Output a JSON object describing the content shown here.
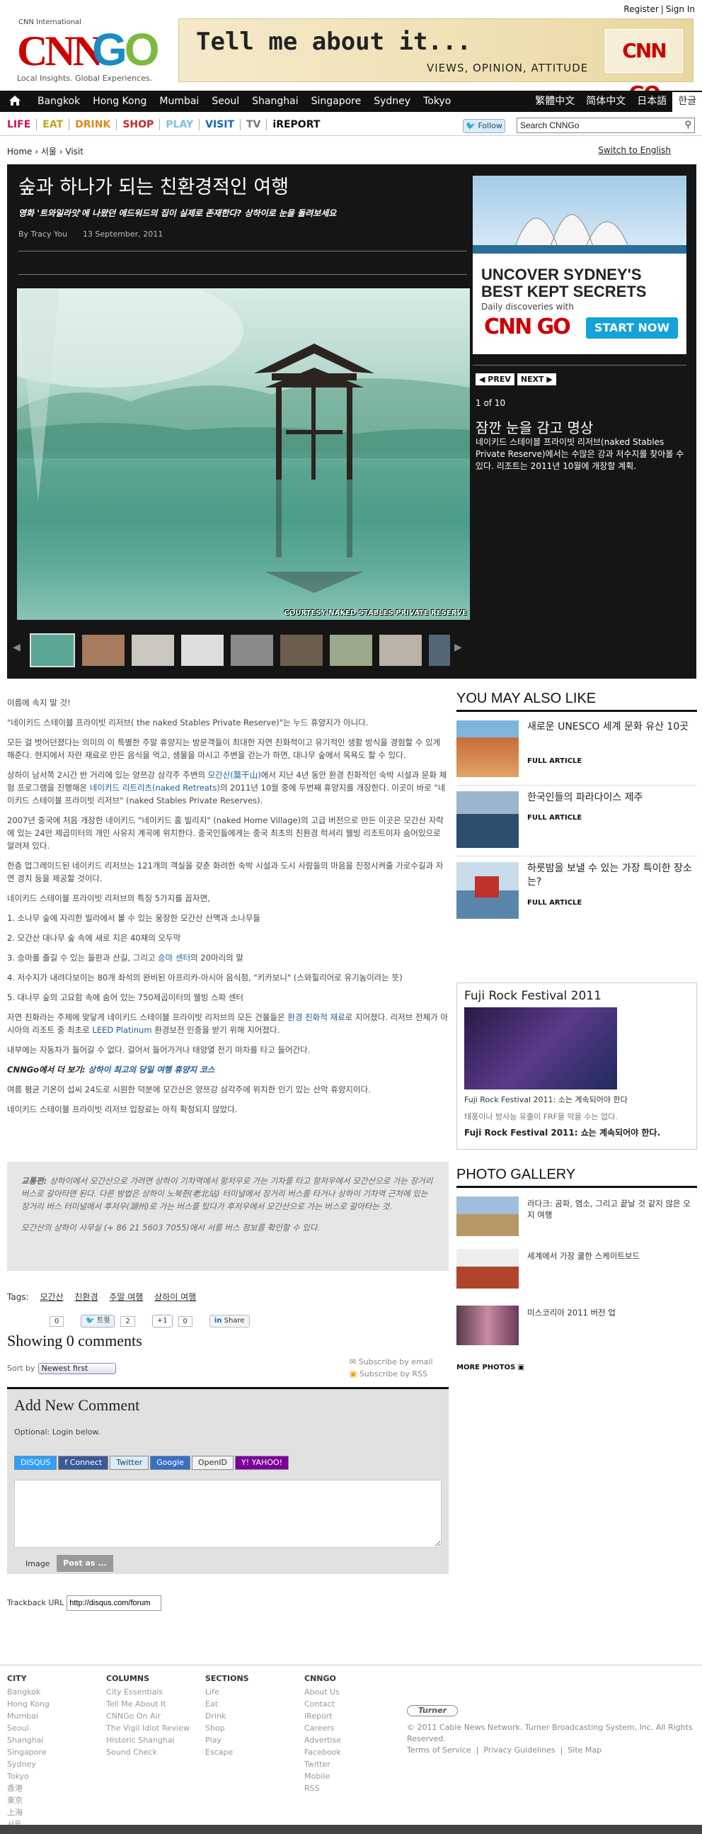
{
  "header": {
    "auth": {
      "register": "Register",
      "signin": "Sign In"
    },
    "logo": {
      "intl": "CNN International",
      "cnn": "CNN",
      "go": "GO",
      "tagline": "Local Insights. Global Experiences."
    },
    "banner": {
      "headline": "Tell me about it...",
      "sub": "VIEWS, OPINION, ATTITUDE",
      "logo": "CNN GO"
    }
  },
  "city_nav": {
    "cities": [
      "Bangkok",
      "Hong Kong",
      "Mumbai",
      "Seoul",
      "Shanghai",
      "Singapore",
      "Sydney",
      "Tokyo"
    ],
    "languages": [
      "繁體中文",
      "简体中文",
      "日本語",
      "한글"
    ]
  },
  "section_nav": {
    "items": [
      {
        "label": "LIFE",
        "color": "#c2185b"
      },
      {
        "label": "EAT",
        "color": "#c0a51b"
      },
      {
        "label": "DRINK",
        "color": "#e08a1e"
      },
      {
        "label": "SHOP",
        "color": "#c62828"
      },
      {
        "label": "PLAY",
        "color": "#7ec1e0"
      },
      {
        "label": "VISIT",
        "color": "#1565c0"
      },
      {
        "label": "TV",
        "color": "#777777"
      },
      {
        "label": "iREPORT",
        "color": "#111111"
      }
    ],
    "follow": "Follow",
    "search_value": "Search CNNGo"
  },
  "breadcrumb": "Home › 서울 › Visit",
  "switch_lang": "Switch to English",
  "gallery": {
    "title": "숲과 하나가 되는 친환경적인 여행",
    "subtitle": "영화 '트와일라잇'에 나왔던 에드워드의 집이 실제로 존재한다? 상하이로 눈을 돌려보세요",
    "author": "By Tracy You",
    "date": "13 September, 2011",
    "photo_credit": "COURTESY NAKED STABLES PRIVATE RESERVE",
    "prev": "◀ PREV",
    "next": "NEXT ▶",
    "counter": "1 of 10",
    "caption_title": "잠깐 눈을 감고 명상",
    "caption_text": "네이키드 스테이블 프라이빗 리저브(naked Stables Private Reserve)에서는 수많은 강과 저수지를 찾아볼 수 있다. 리조트는 2011년 10월에 개장할 계획.",
    "ad": {
      "line1": "UNCOVER SYDNEY'S",
      "line2": "BEST KEPT SECRETS",
      "line3": "Daily discoveries with",
      "logo": "CNN GO",
      "cta": "START NOW"
    }
  },
  "article": {
    "p1": "이름에 속지 말 것!",
    "p2": "\"네이키드 스테이블 프라이빗 리저브( the naked Stables Private Reserve)\"는 누드 휴양지가 아니다.",
    "p3": "모든 걸 벗어던졌다는 의미의 이 특별한 주말 휴양지는 방문객들이 최대한 자연 친화적이고 유기적인 생활 방식을 경험할 수 있게 해준다. 현지에서 자란 재료로 만든 음식을 먹고, 샘물을 마시고 주변을 걷는가 하면, 대나무 숲에서 목욕도 할 수 있다.",
    "p4a": "상하이 남서쪽 2시간 반 거리에 있는 양쯔강 삼각주 주변의 ",
    "p4link1": "모간산(莫干山)",
    "p4b": "에서 지난 4년 동안 환경 친화적인 숙박 시설과 문화 체험 프로그램을 진행해온 ",
    "p4link2": "네이키드 리트리츠(naked Retreats)",
    "p4c": "의 2011년 10월 중에 두번째 휴양지를 개장한다. 이곳이 바로 \"네이키드 스테이블 프라이빗 리저브\" (naked Stables Private Reserves).",
    "p5": "2007년 중국에 처음 개장한 네이키드 \"네이키드 홈 빌리지\" (naked Home Village)의 고급 버전으로 만든 이곳은 모간산 자락에 있는 24만 제곱미터의 개인 사유지 계곡에 위치한다. 중국인들에게는 중국 최초의 친환경 럭셔리 웰빙 리조트이자 숨어있으로 알려져 있다.",
    "p6": "한층 업그레이드된 네이키드 리저브는 121개의 객실을 갖춘 화려한 숙박 시설과 도시 사람들의 마음을 진정시켜줄 가로수길과 자연 경치 등을 제공할 것이다.",
    "p7": "네이키드 스테이블 프라이빗 리저브의 특징 5가지를 꼽자면,",
    "li1": "1. 소나무 숲에 자리한 빌라에서 볼 수 있는 웅장한 모간산 산맥과 소나무들",
    "li2": "2. 모간산 대나무 숲 속에 새로 지은 40채의 오두막",
    "li3a": "3. 승마를 즐길 수 있는 들판과 산길, 그리고 ",
    "li3link": "승마 센터",
    "li3b": "의 20마리의 말",
    "li4": "4. 저수지가 내려다보이는 80개 좌석의 완비된 아프리카-아시아 음식점, \"키카보니\" (스와힐리어로 유기농이라는 뜻)",
    "li5": "5. 대나무 숲의 고요함 속에 숨어 있는 750제곱미터의 웰빙 스파 센터",
    "p8a": "자연 친화라는 주제에 맞닿게 네이키드 스테이블 프라이빗 리저브의 모든 건물들은 ",
    "p8link1": "환경 친화적 재료",
    "p8b": "로 지어졌다. 리저브 전체가 아시아의 리조트 중 최초로 ",
    "p8link2": "LEED Platinum",
    "p8c": " 환경보전 인증을 받기 위해 지어졌다.",
    "p9": "내부에는 자동차가 들어갈 수 없다. 걸어서 들어가거나 태양열 전기 마차를 타고 들어간다.",
    "more_label": "CNNGo에서 더 보기: ",
    "more_link": "상하이 최고의 당일 여행 휴양지 코스",
    "p10": "여름 평균 기온이 섭씨 24도로 시원한 덕분에 모간산은 양쯔강 삼각주에 위치한 인기 있는 산악 휴양지이다.",
    "p11": "네이키드 스테이블 프라이빗 리저브 입장료는 아직 확정되지 않았다.",
    "note1a": "교통편: ",
    "note1": "상하이에서 모간산으로 가려면 상하이 기차역에서 항저우로 가는 기차를 타고 항저우에서 모간산으로 가는 장거리 버스로 갈아타면 된다. 다른 방법은 상하이 노북쥔(老北站) 터미널에서 장거리 버스를 타거나 상하이 기차역 근처에 있는 장거리 버스 터미널에서 후저우(湖州)로 가는 버스를 탔다가 후저우에서 모간산으로 가는 버스로 갈아타는 것.",
    "note2": "모간산의 상하이 사무실 (+ 86 21 5603 7055)에서 서를 버스 정보를 확인할 수 있다."
  },
  "tags": {
    "label": "Tags:",
    "items": [
      "모간산",
      "친환경",
      "주말 여행",
      "상하이 여행"
    ]
  },
  "social": {
    "count1": "0",
    "tweet": "트윗",
    "tweet_count": "2",
    "plusone": "+1",
    "plus_count": "0",
    "share": "Share"
  },
  "comments": {
    "showing": "Showing 0 comments",
    "sort_label": "Sort by",
    "sort_value": "Newest first",
    "subscribe_email": "Subscribe by email",
    "subscribe_rss": "Subscribe by RSS",
    "add_title": "Add New Comment",
    "optional": "Optional: Login below.",
    "logins": [
      "DISQUS",
      "f Connect",
      "Twitter",
      "Google",
      "OpenID",
      "Y! YAHOO!"
    ],
    "image_label": "Image",
    "post_label": "Post as ...",
    "trackback_label": "Trackback URL",
    "trackback_value": "http://disqus.com/forum"
  },
  "right": {
    "also_like": "YOU MAY ALSO LIKE",
    "stories": [
      {
        "title": "새로운 UNESCO 세계 문화 유산 10곳",
        "link": "FULL ARTICLE"
      },
      {
        "title": "한국인들의 파라다이스 제주",
        "link": "FULL ARTICLE"
      },
      {
        "title": "하룻밤을 보낼 수 있는 가장 특이한 장소는?",
        "link": "FULL ARTICLE"
      }
    ],
    "fuji": {
      "title": "Fuji Rock Festival 2011",
      "caption": "Fuji Rock Festival 2011: 소는 계속되어야 한다",
      "desc": "태풍이나 방사능 유출이 FRF을 막을 수는 없다.",
      "link": "Fuji Rock Festival 2011: 쇼는 계속되어야 한다."
    },
    "photo_gallery": "PHOTO GALLERY",
    "gallery_items": [
      "라다크: 곰파, 염소, 그리고 끝날 것 같지 않은 오지 여행",
      "세계에서 가장 쿨한 스케이트보드",
      "미스코리아 2011 버전 업"
    ],
    "more_photos": "MORE PHOTOS"
  },
  "footer": {
    "city": {
      "title": "CITY",
      "items": [
        "Bangkok",
        "Hong Kong",
        "Mumbai",
        "Seoul",
        "Shanghai",
        "Singapore",
        "Sydney",
        "Tokyo",
        "香港",
        "東京",
        "上海",
        "서울"
      ]
    },
    "columns": {
      "title": "COLUMNS",
      "items": [
        "City Essentials",
        "Tell Me About It",
        "CNNGo On Air",
        "The Vigil Idiot Review",
        "Historic Shanghai",
        "Sound Check"
      ]
    },
    "sections": {
      "title": "SECTIONS",
      "items": [
        "Life",
        "Eat",
        "Drink",
        "Shop",
        "Play",
        "Escape"
      ]
    },
    "cnngo": {
      "title": "CNNGO",
      "items": [
        "About Us",
        "Contact",
        "iReport",
        "Careers",
        "Advertise",
        "Facebook",
        "Twitter",
        "Mobile",
        "RSS"
      ]
    },
    "turner": "Turner",
    "copyright": "© 2011 Cable News Network. Turner Broadcasting System, Inc. All Rights Reserved.",
    "links": [
      "Terms of Service",
      "Privacy Guidelines",
      "Site Map"
    ]
  }
}
